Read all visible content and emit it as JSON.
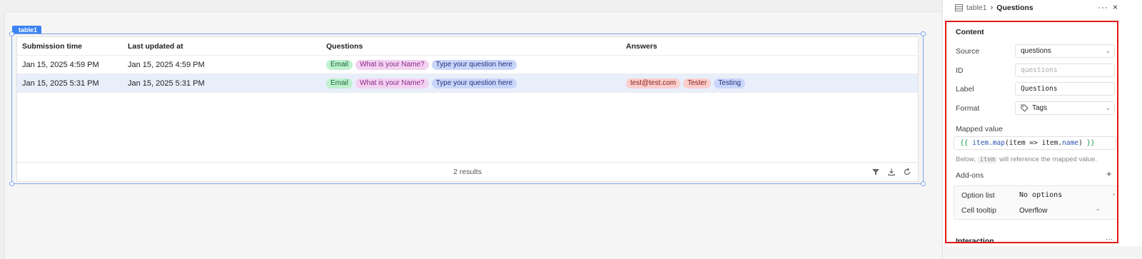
{
  "canvas": {
    "component_tag": "table1",
    "table": {
      "columns": [
        "Submission time",
        "Last updated at",
        "Questions",
        "Answers"
      ],
      "rows": [
        {
          "submission_time": "Jan 15, 2025 4:59 PM",
          "last_updated": "Jan 15, 2025 4:59 PM",
          "questions": [
            "Email",
            "What is your Name?",
            "Type your question here"
          ],
          "answers": []
        },
        {
          "submission_time": "Jan 15, 2025 5:31 PM",
          "last_updated": "Jan 15, 2025 5:31 PM",
          "questions": [
            "Email",
            "What is your Name?",
            "Type your question here"
          ],
          "answers": [
            "test@test.com",
            "Tester",
            "Testing"
          ]
        }
      ],
      "footer": {
        "results": "2 results",
        "icons": [
          "filter-icon",
          "download-icon",
          "refresh-icon"
        ]
      }
    }
  },
  "panel": {
    "breadcrumb": {
      "parent": "table1",
      "separator": "›",
      "current": "Questions"
    },
    "more_label": "···",
    "close_label": "×",
    "content_title": "Content",
    "source": {
      "label": "Source",
      "value": "questions"
    },
    "id": {
      "label": "ID",
      "placeholder": "questions"
    },
    "label_field": {
      "label": "Label",
      "value": "Questions"
    },
    "format": {
      "label": "Format",
      "value": "Tags",
      "icon": "tag-icon"
    },
    "mapped_value": {
      "label": "Mapped value",
      "code_open": "{{",
      "code_item": "item",
      "code_dot_map": ".map",
      "code_args": "(item => item.",
      "code_name": "name",
      "code_close_paren": ")",
      "code_close": "}}"
    },
    "hint": {
      "before": "Below,",
      "code": "item",
      "after": "will reference the mapped value."
    },
    "addons": {
      "label": "Add-ons",
      "add_label": "+",
      "items": [
        {
          "label": "Option list",
          "value": "No options",
          "chevron": "›"
        },
        {
          "label": "Cell tooltip",
          "value": "Overflow",
          "chevron": "⌄"
        }
      ]
    },
    "interaction_title": "Interaction",
    "interaction_more": "···"
  }
}
